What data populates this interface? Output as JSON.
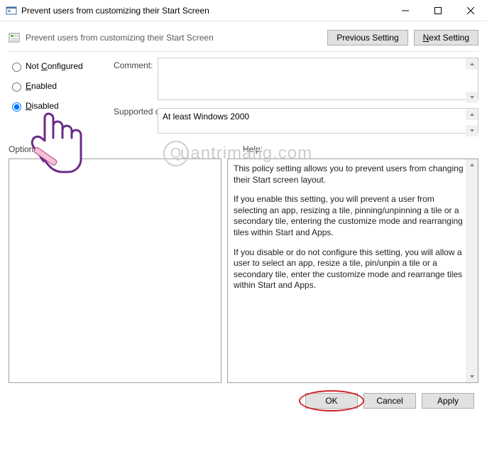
{
  "titlebar": {
    "title": "Prevent users from customizing their Start Screen"
  },
  "subheader": {
    "title": "Prevent users from customizing their Start Screen",
    "prev_label": "Previous Setting",
    "next_label": "Next Setting",
    "next_underline_char": "N"
  },
  "radios": {
    "not_configured": "Not Configured",
    "enabled": "Enabled",
    "disabled": "Disabled",
    "not_configured_underline": "C",
    "enabled_underline": "E",
    "disabled_underline": "D",
    "selected": "disabled"
  },
  "labels": {
    "comment": "Comment:",
    "supported_on": "Supported on:",
    "options": "Options:",
    "help": "Help:"
  },
  "fields": {
    "comment_value": "",
    "supported_value": "At least Windows 2000"
  },
  "help": {
    "p1": "This policy setting allows you to prevent users from changing their Start screen layout.",
    "p2": "If you enable this setting, you will prevent a user from selecting an app, resizing a tile, pinning/unpinning a tile or a secondary tile, entering the customize mode and rearranging tiles within Start and Apps.",
    "p3": "If you disable or do not configure this setting, you will allow a user to select an app, resize a tile, pin/unpin a tile or a secondary tile, enter the customize mode and rearrange tiles within Start and Apps."
  },
  "buttons": {
    "ok": "OK",
    "cancel": "Cancel",
    "apply": "Apply"
  },
  "watermark": {
    "text": "uantrimang.com"
  }
}
